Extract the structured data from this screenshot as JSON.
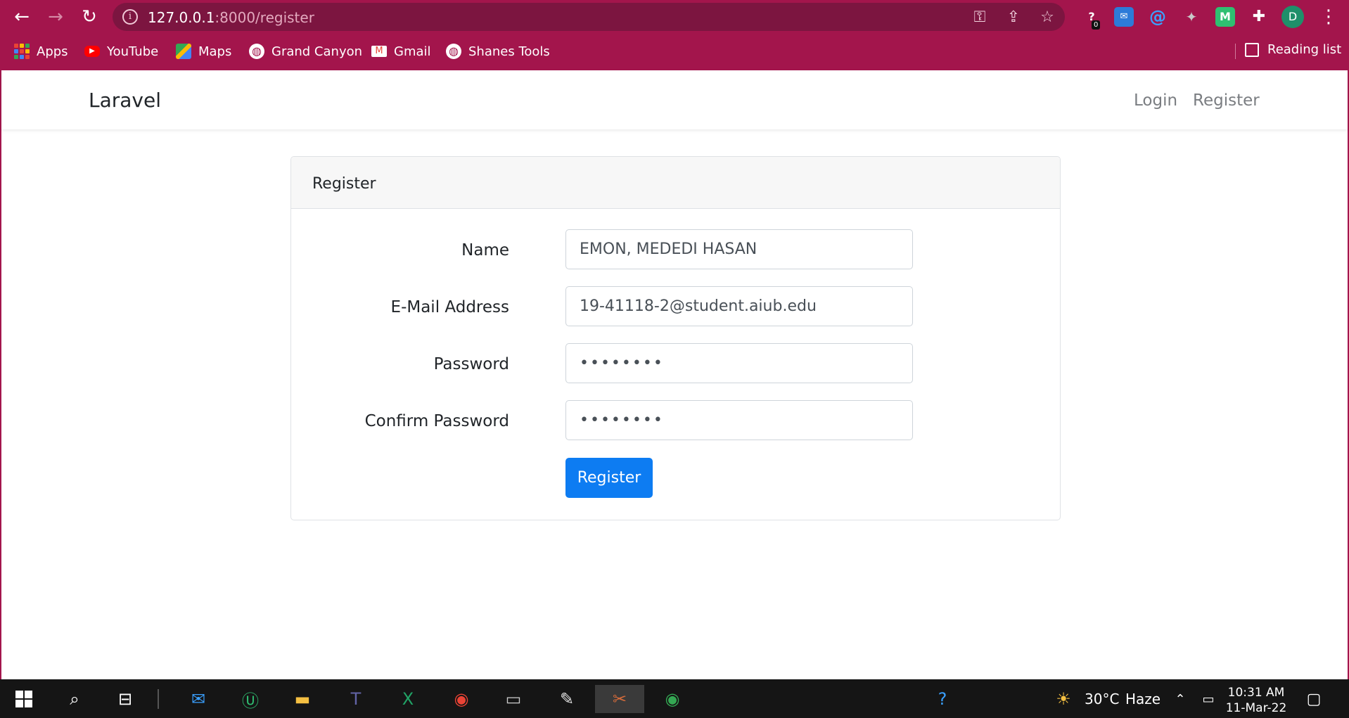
{
  "browser": {
    "url_host": "127.0.0.1",
    "url_path": ":8000/register",
    "extension_badge": "0",
    "profile_initial": "D",
    "extensions": [
      {
        "icon": "help-extension-icon",
        "color": "#7c1540"
      },
      {
        "icon": "mail-extension-icon",
        "color": "#2d7bd8"
      },
      {
        "icon": "at-extension-icon",
        "color": "#7c1540"
      },
      {
        "icon": "puzzle-extension-icon",
        "color": "#7c1540"
      },
      {
        "icon": "m-extension-icon",
        "color": "#2fbf71",
        "letter": "M"
      },
      {
        "icon": "extensions-puzzle-icon",
        "color": "#7c1540"
      }
    ],
    "bookmarks": [
      {
        "label": "Apps",
        "icon": "apps-grid-icon"
      },
      {
        "label": "YouTube",
        "icon": "youtube-icon",
        "color": "#ff0000"
      },
      {
        "label": "Maps",
        "icon": "maps-icon"
      },
      {
        "label": "Grand Canyon",
        "icon": "globe-icon"
      },
      {
        "label": "Gmail",
        "icon": "gmail-icon"
      },
      {
        "label": "Shanes Tools",
        "icon": "globe-icon"
      }
    ],
    "reading_list": "Reading list"
  },
  "navbar": {
    "brand": "Laravel",
    "links": [
      "Login",
      "Register"
    ]
  },
  "card": {
    "header": "Register",
    "fields": [
      {
        "label": "Name",
        "value": "EMON, MEDEDI HASAN",
        "type": "text"
      },
      {
        "label": "E-Mail Address",
        "value": "19-41118-2@student.aiub.edu",
        "type": "email"
      },
      {
        "label": "Password",
        "value": "••••••••",
        "type": "password"
      },
      {
        "label": "Confirm Password",
        "value": "••••••••",
        "type": "password"
      }
    ],
    "submit_label": "Register"
  },
  "taskbar": {
    "weather_temp": "30°C",
    "weather_desc": "Haze",
    "time": "10:31 AM",
    "date": "11-Mar-22"
  },
  "colors": {
    "browser_frame": "#a3154c",
    "omnibox": "#7c1540",
    "primary_button": "#0d7cf2",
    "taskbar": "#151515"
  }
}
